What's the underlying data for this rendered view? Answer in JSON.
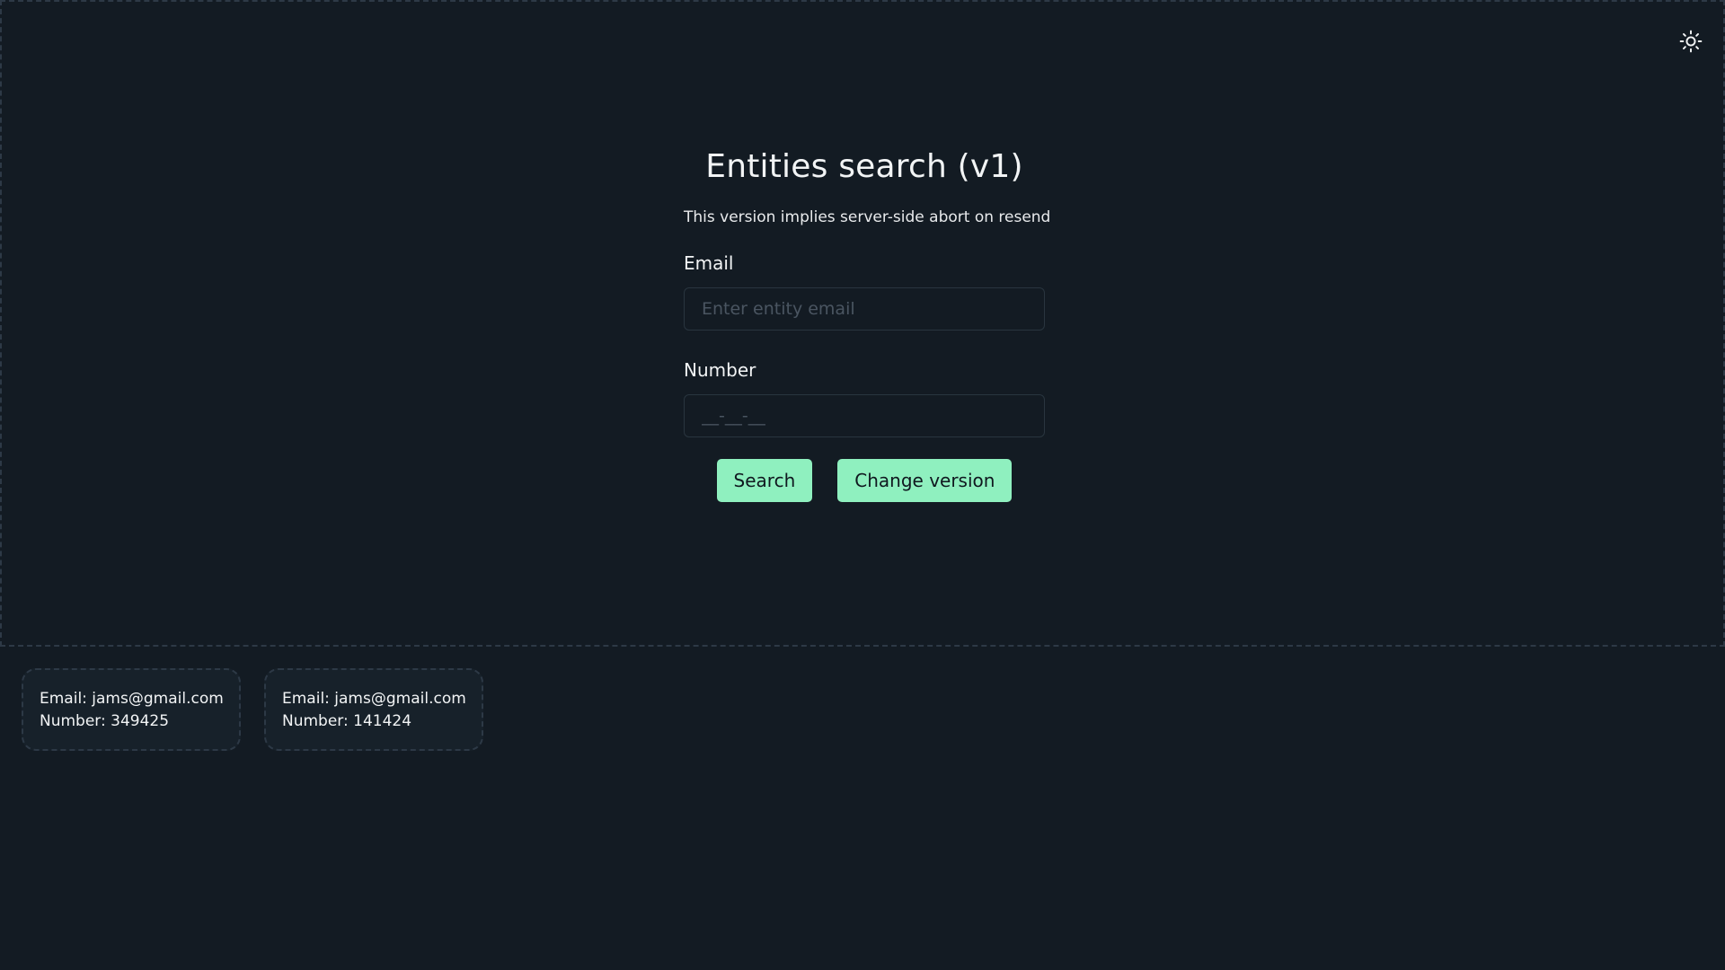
{
  "header": {
    "theme_toggle_icon": "sun-icon"
  },
  "form": {
    "title": "Entities search (v1)",
    "subtitle": "This version implies server-side abort on resend",
    "email": {
      "label": "Email",
      "placeholder": "Enter entity email",
      "value": ""
    },
    "number": {
      "label": "Number",
      "placeholder": "__-__-__",
      "value": ""
    },
    "buttons": {
      "search_label": "Search",
      "change_version_label": "Change version"
    }
  },
  "results": [
    {
      "email": "Email: jams@gmail.com",
      "number": "Number: 349425"
    },
    {
      "email": "Email: jams@gmail.com",
      "number": "Number: 141424"
    }
  ],
  "colors": {
    "background": "#131b23",
    "accent": "#8ff0bf",
    "border": "#2d3946"
  }
}
